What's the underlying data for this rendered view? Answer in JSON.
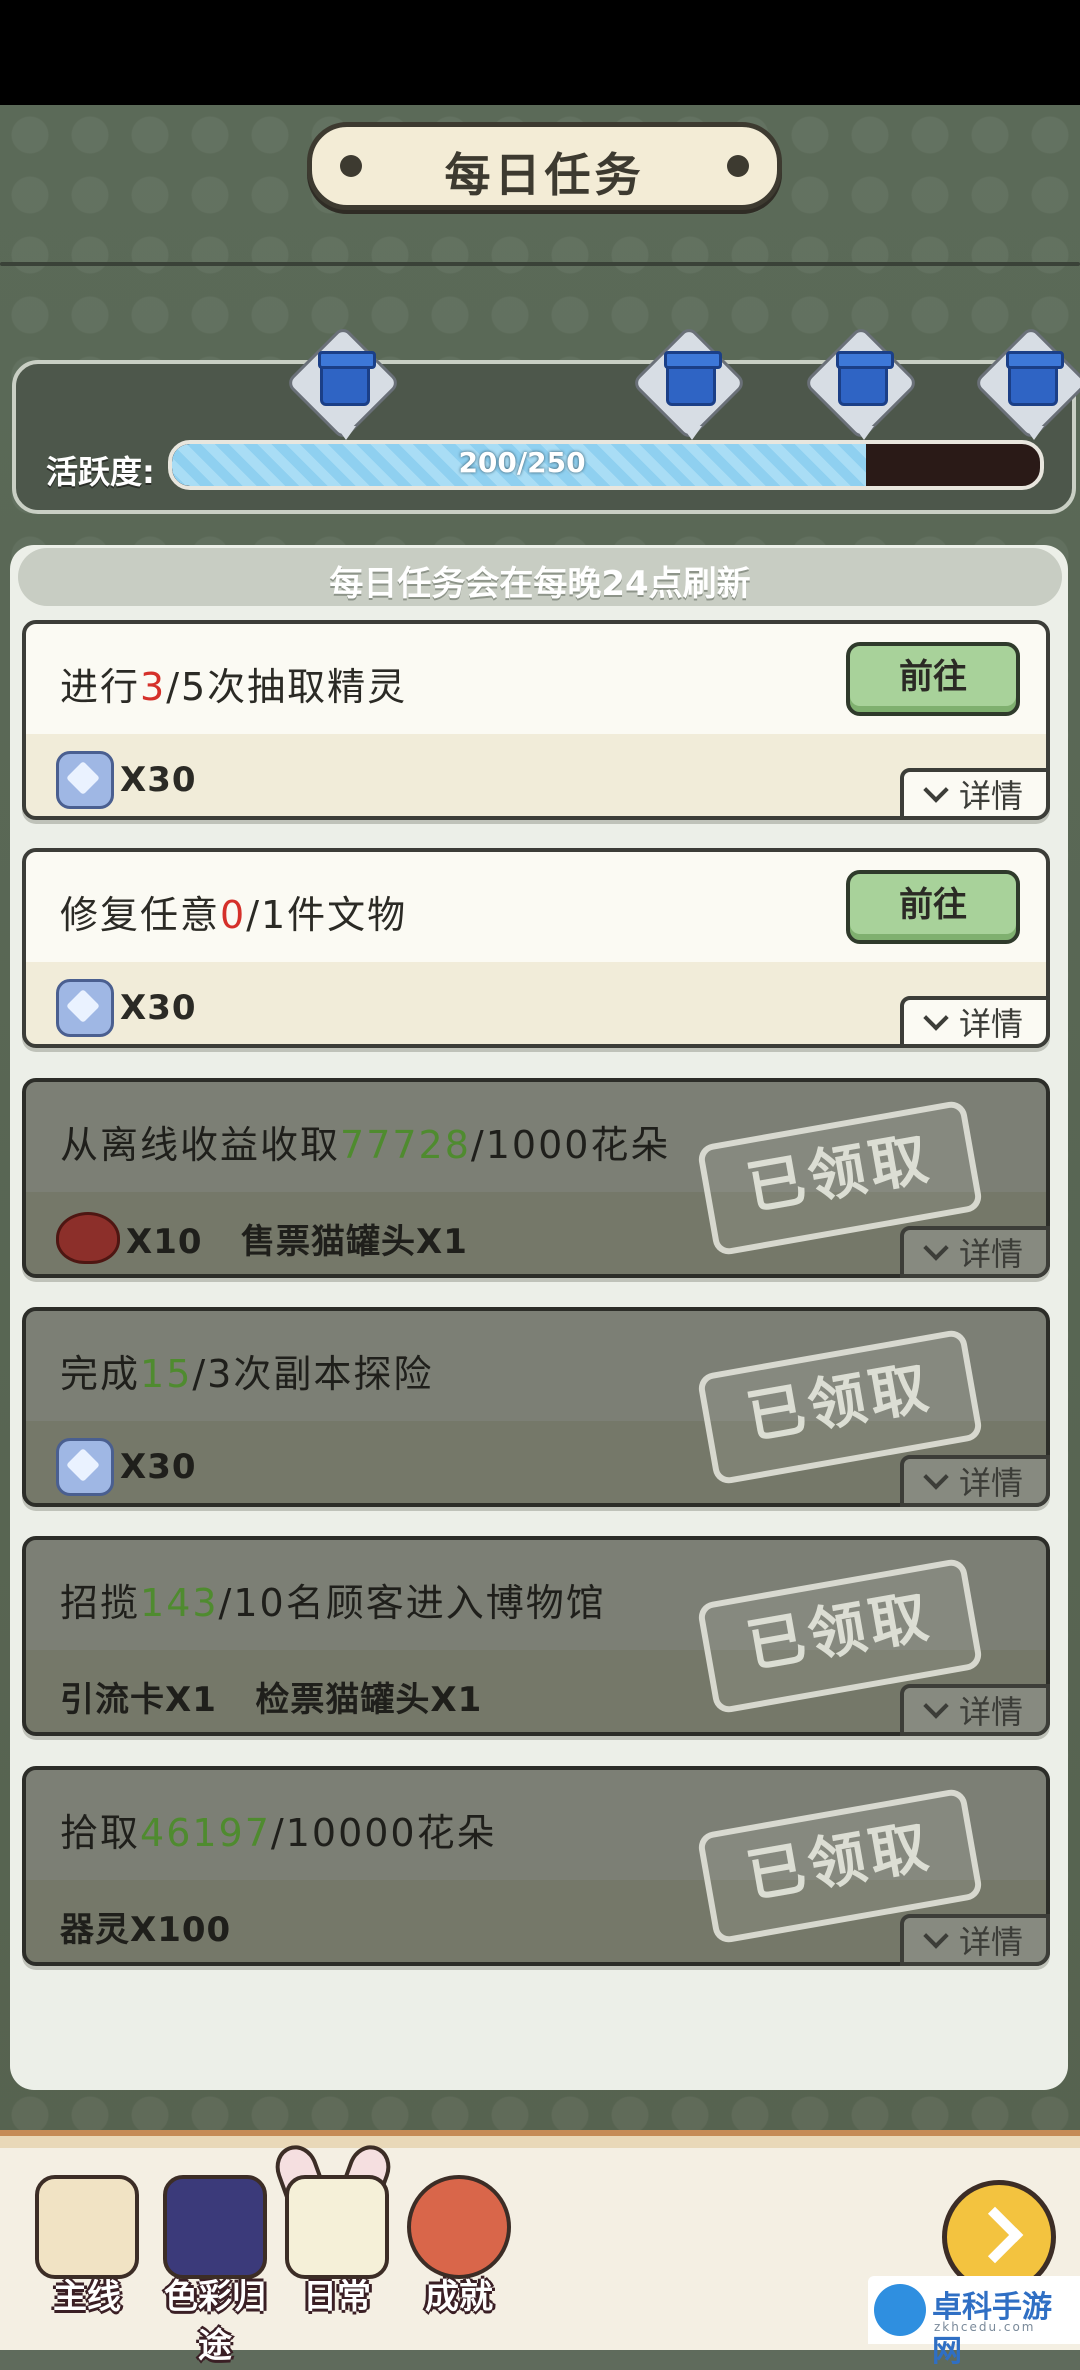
{
  "header": {
    "title": "每日任务"
  },
  "activity": {
    "label": "活跃度:",
    "value": 200,
    "max": 250,
    "progress_text": "200/250",
    "chest_count": 4
  },
  "list_header": "每日任务会在每晚24点刷新",
  "tasks": [
    {
      "desc_pre": "进行",
      "desc_num": "3",
      "desc_post": "/5次抽取精灵",
      "num_color": "red",
      "reward_icon": "gem-icon",
      "reward": "X30",
      "status": "go",
      "go_label": "前往",
      "detail_label": "详情"
    },
    {
      "desc_pre": "修复任意",
      "desc_num": "0",
      "desc_post": "/1件文物",
      "num_color": "red",
      "reward_icon": "gem-icon",
      "reward": "X30",
      "status": "go",
      "go_label": "前往",
      "detail_label": "详情"
    },
    {
      "desc_pre": "从离线收益收取",
      "desc_num": "77728",
      "desc_post": "/1000花朵",
      "num_color": "green",
      "reward_icon": "heart-icon",
      "reward": "X10   售票猫罐头X1",
      "status": "claimed",
      "claimed_label": "已领取",
      "detail_label": "详情"
    },
    {
      "desc_pre": "完成",
      "desc_num": "15",
      "desc_post": "/3次副本探险",
      "num_color": "green",
      "reward_icon": "gem-icon",
      "reward": "X30",
      "status": "claimed",
      "claimed_label": "已领取",
      "detail_label": "详情"
    },
    {
      "desc_pre": "招揽",
      "desc_num": "143",
      "desc_post": "/10名顾客进入博物馆",
      "num_color": "green",
      "reward_icon": "",
      "reward": "引流卡X1   检票猫罐头X1",
      "status": "claimed",
      "claimed_label": "已领取",
      "detail_label": "详情"
    },
    {
      "desc_pre": "拾取",
      "desc_num": "46197",
      "desc_post": "/10000花朵",
      "num_color": "green",
      "reward_icon": "",
      "reward": "器灵X100",
      "status": "claimed",
      "claimed_label": "已领取",
      "detail_label": "详情"
    }
  ],
  "nav": {
    "items": [
      {
        "label": "主线",
        "icon": "script-book-icon"
      },
      {
        "label": "色彩归途",
        "icon": "painter-icon"
      },
      {
        "label": "日常",
        "icon": "calendar-icon"
      },
      {
        "label": "成就",
        "icon": "trophy-icon"
      }
    ],
    "active": "日常",
    "return_icon": "return-arrow-icon"
  },
  "watermark": {
    "name": "卓科手游网",
    "sub": "zkhcedu.com"
  },
  "colors": {
    "accent_green": "#a8d29a",
    "progress_blue": "#8fd0f0",
    "highlight_red": "#d5302a",
    "highlight_green": "#5aa23d"
  }
}
